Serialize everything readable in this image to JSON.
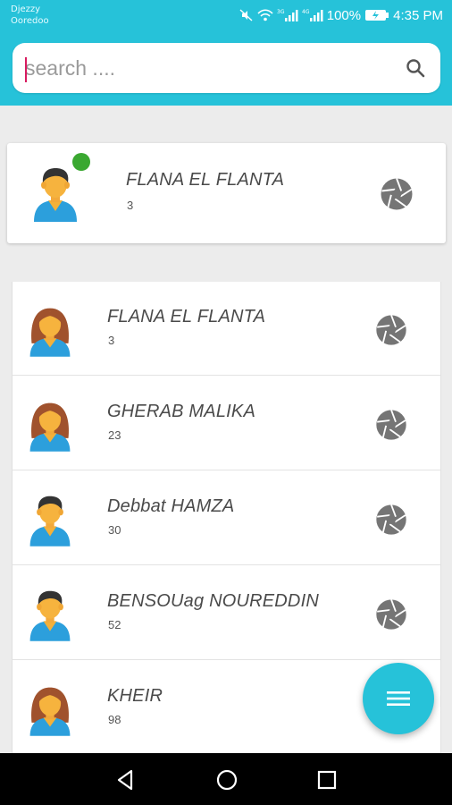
{
  "status_bar": {
    "carrier_1": "Djezzy",
    "carrier_2": "Ooredoo",
    "battery": "100%",
    "time": "4:35 PM"
  },
  "search": {
    "placeholder": "search ...."
  },
  "current_user": {
    "name": "FLANA EL FLANTA",
    "count": "3",
    "avatar": "male-avatar",
    "online": true
  },
  "contacts": [
    {
      "name": "FLANA EL FLANTA",
      "count": "3",
      "avatar": "female-avatar"
    },
    {
      "name": "GHERAB MALIKA",
      "count": "23",
      "avatar": "female-avatar"
    },
    {
      "name": "Debbat HAMZA",
      "count": "30",
      "avatar": "male-avatar"
    },
    {
      "name": "BENSOUag NOUREDDIN",
      "count": "52",
      "avatar": "male-avatar"
    },
    {
      "name": "KHEIR",
      "count": "98",
      "avatar": "female-avatar"
    }
  ],
  "colors": {
    "accent": "#26c2d9",
    "online": "#3aa831",
    "shutter_icon": "#757575"
  },
  "icons": {
    "search": "search-icon",
    "row_action": "camera-shutter-icon",
    "fab": "menu-icon",
    "nav_back": "back-triangle-icon",
    "nav_home": "home-circle-icon",
    "nav_recents": "recents-square-icon"
  }
}
